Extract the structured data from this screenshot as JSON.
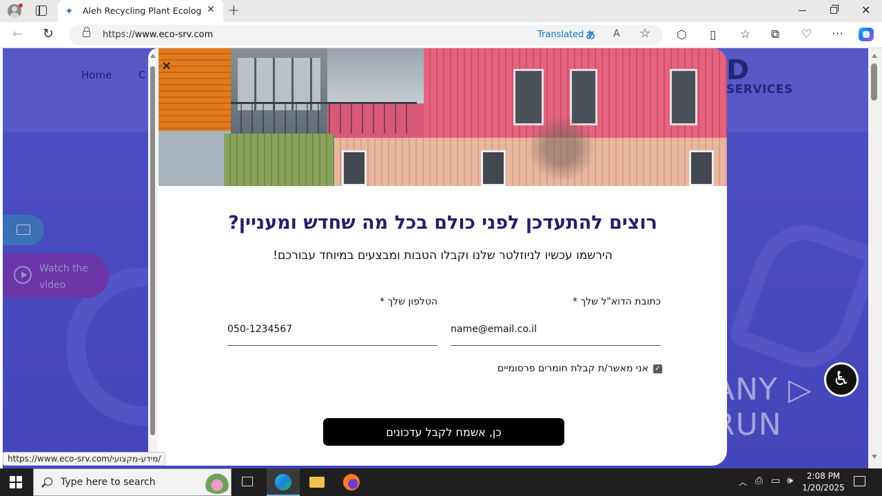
{
  "browser": {
    "tab_title": "Aleh Recycling Plant Ecology Services",
    "tab_close": "✕",
    "new_tab": "+",
    "url_prefix": "https://",
    "url_host": "www.eco-srv.com",
    "translated_label": "Translated",
    "status_url": "https://www.eco-srv.com/מידע-מקצועי/"
  },
  "site": {
    "nav_home": "Home",
    "nav_partial": "C",
    "logo_big": "D",
    "logo_small": "SERVICES",
    "video_label": "Watch the video"
  },
  "modal": {
    "close_glyph": "×",
    "title": "רוצים להתעדכן לפני כולם בכל מה שחדש ומעניין?",
    "subtitle": "הירשמו עכשיו לניוזלטר שלנו וקבלו הטבות ומבצעים במיוחד עבורכם!",
    "email_label": "כתובת הדוא\"ל שלך *",
    "email_value": "name@email.co.il",
    "phone_label": "הטלפון שלך *",
    "phone_value": "050-1234567",
    "consent_label": "אני מאשר/ת קבלת חומרים פרסומיים",
    "consent_checked": true,
    "submit_label": "כן, אשמח לקבל עדכונים"
  },
  "overlay": {
    "a11y_glyph": "♿",
    "watermark": "ANY ▷ RUN"
  },
  "taskbar": {
    "search_placeholder": "Type here to search",
    "time": "2:08 PM",
    "date": "1/20/2025"
  },
  "colors": {
    "modal_title": "#241f6b",
    "site_background": "#4447b8",
    "submit_button": "#000000",
    "translated_link": "#1a73c2"
  }
}
